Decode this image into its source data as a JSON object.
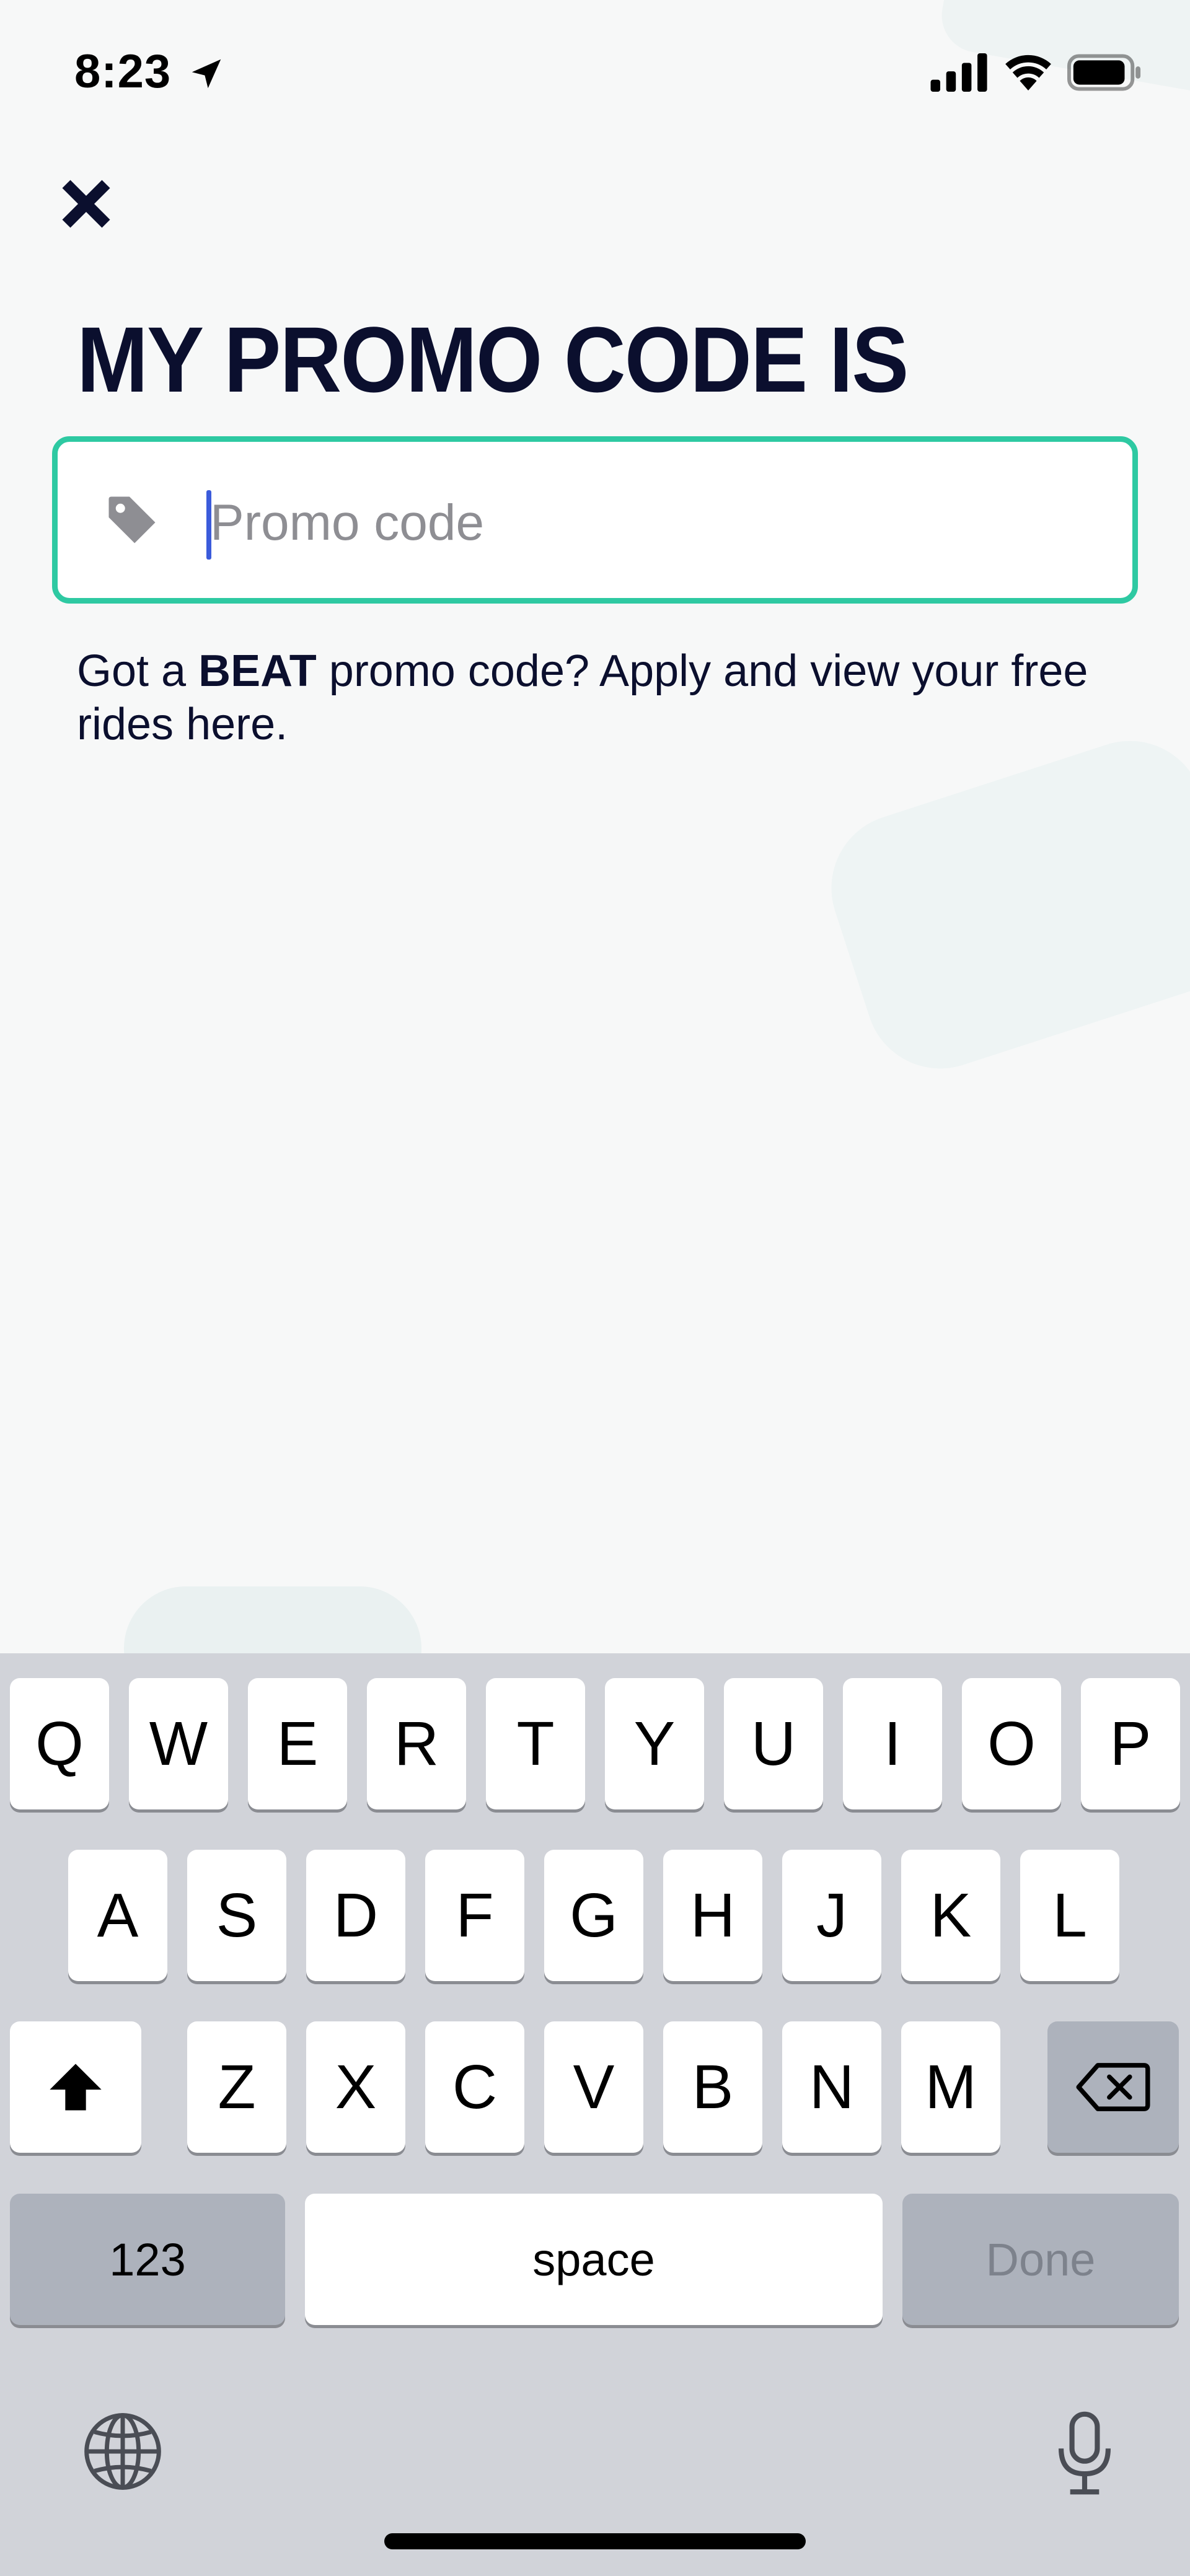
{
  "status_bar": {
    "time": "8:23",
    "icons": [
      "location-arrow-icon",
      "cellular-signal-icon",
      "wifi-icon",
      "battery-icon"
    ]
  },
  "header": {
    "close_icon": "close-icon",
    "title": "MY PROMO CODE IS"
  },
  "promo": {
    "placeholder": "Promo code",
    "value": "",
    "icon": "tag-icon",
    "border_color": "#2ec9a2"
  },
  "help": {
    "prefix": "Got a ",
    "brand": "BEAT",
    "suffix": " promo code? Apply and view your free rides here."
  },
  "keyboard": {
    "row1": [
      "Q",
      "W",
      "E",
      "R",
      "T",
      "Y",
      "U",
      "I",
      "O",
      "P"
    ],
    "row2": [
      "A",
      "S",
      "D",
      "F",
      "G",
      "H",
      "J",
      "K",
      "L"
    ],
    "row3": [
      "Z",
      "X",
      "C",
      "V",
      "B",
      "N",
      "M"
    ],
    "numbers_label": "123",
    "space_label": "space",
    "done_label": "Done",
    "icons": [
      "shift-icon",
      "backspace-icon",
      "globe-icon",
      "microphone-icon"
    ]
  }
}
